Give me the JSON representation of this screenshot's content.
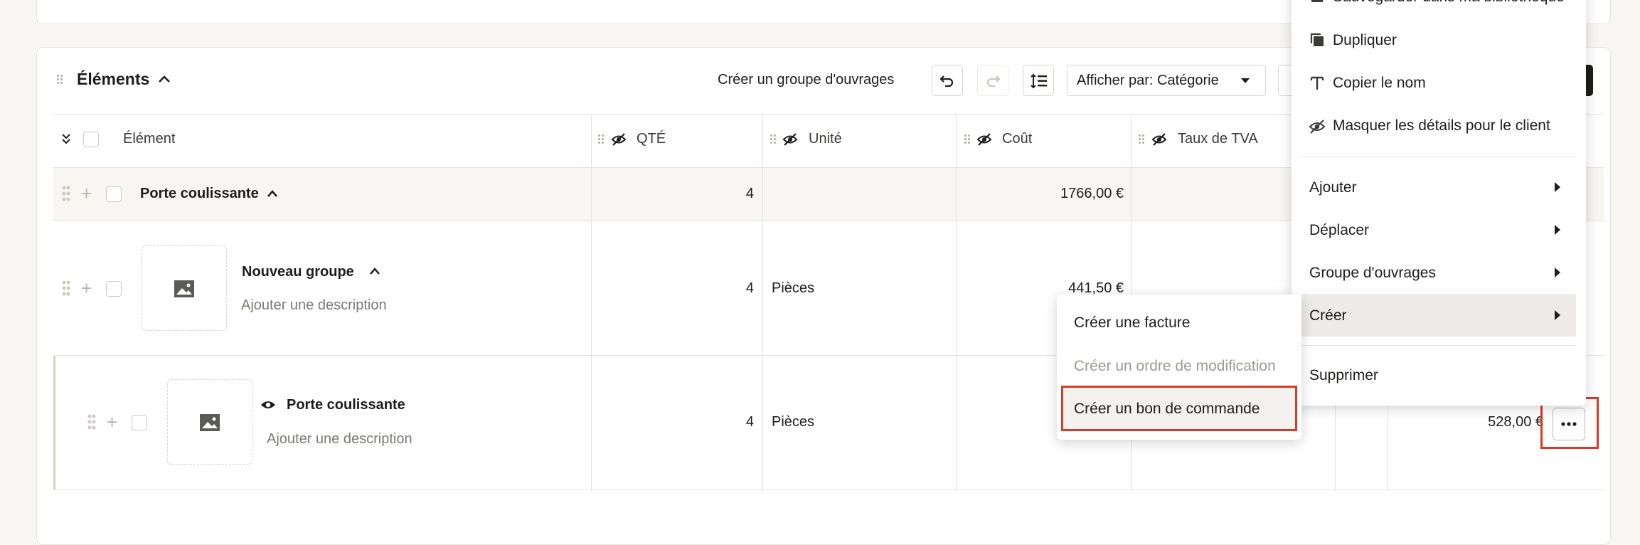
{
  "section": {
    "title": "Éléments",
    "create_group_label": "Créer un groupe d'ouvrages",
    "display_by_label": "Afficher par: Catégorie"
  },
  "table": {
    "headers": {
      "element": "Élément",
      "qty": "QTÉ",
      "unit": "Unité",
      "cost": "Coût",
      "vat": "Taux de TVA"
    },
    "rows": [
      {
        "name": "Porte coulissante",
        "qty": "4",
        "unit": "",
        "cost": "1766,00 €"
      },
      {
        "name": "Nouveau groupe",
        "description": "Ajouter une description",
        "qty": "4",
        "unit": "Pièces",
        "cost": "441,50 €"
      },
      {
        "name": "Porte coulissante",
        "description": "Ajouter une description",
        "qty": "4",
        "unit": "Pièces",
        "total": "528,00 €"
      }
    ]
  },
  "context_menu": {
    "items": [
      {
        "label": "Sauvegarder dans ma bibliothèque",
        "icon": "library-icon"
      },
      {
        "label": "Dupliquer",
        "icon": "copy-icon"
      },
      {
        "label": "Copier le nom",
        "icon": "text-icon"
      },
      {
        "label": "Masquer les détails pour le client",
        "icon": "eye-off-icon"
      },
      {
        "label": "Ajouter"
      },
      {
        "label": "Déplacer"
      },
      {
        "label": "Groupe d'ouvrages"
      },
      {
        "label": "Créer"
      },
      {
        "label": "Supprimer"
      }
    ]
  },
  "submenu": {
    "items": [
      {
        "label": "Créer une facture",
        "disabled": false
      },
      {
        "label": "Créer un ordre de modification",
        "disabled": true
      },
      {
        "label": "Créer un bon de commande",
        "disabled": false
      }
    ]
  },
  "colors": {
    "highlight": "#d93a26",
    "accent_dark": "#1d1d1b",
    "group_row_bg": "#f7f6f3"
  }
}
